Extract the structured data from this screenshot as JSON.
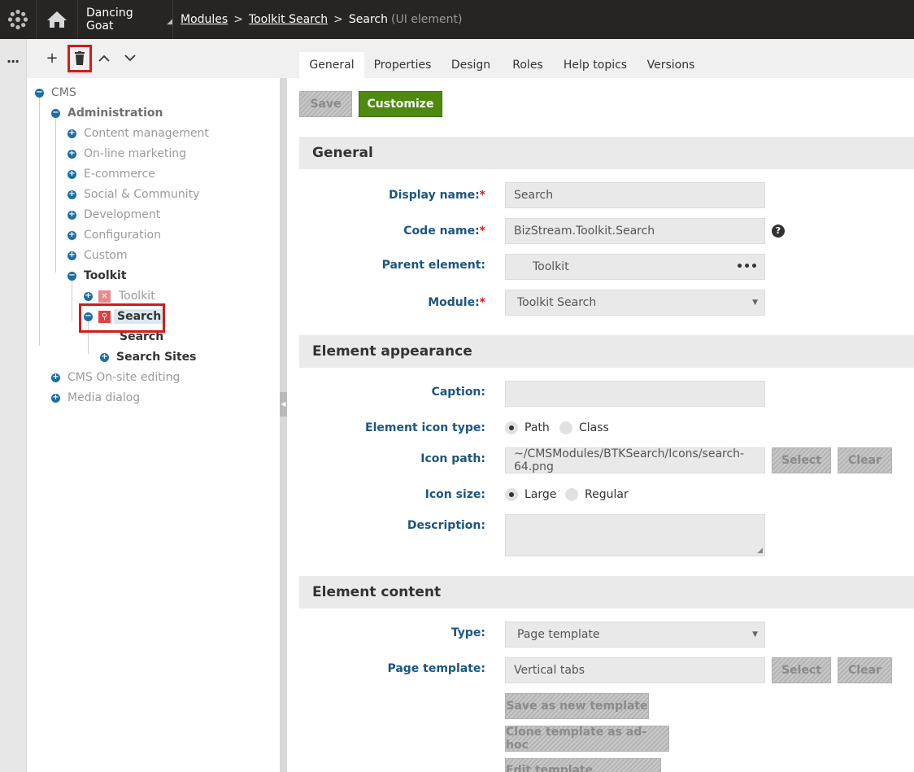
{
  "topbar": {
    "site_name": "Dancing Goat",
    "breadcrumbs": [
      "Modules",
      "Toolkit Search"
    ],
    "current": "Search",
    "current_suffix": "(UI element)"
  },
  "rail": {
    "menu_label": "..."
  },
  "tree_toolbar": {
    "add": "+",
    "up": "^",
    "down": "v"
  },
  "tree": {
    "root": "CMS",
    "administration": "Administration",
    "children": [
      "Content management",
      "On-line marketing",
      "E-commerce",
      "Social & Community",
      "Development",
      "Configuration",
      "Custom"
    ],
    "toolkit": "Toolkit",
    "toolkit_child": "Toolkit",
    "search": "Search",
    "search_child": "Search",
    "search_sites": "Search Sites",
    "cms_onsite": "CMS On-site editing",
    "media_dialog": "Media dialog"
  },
  "tabs": [
    "General",
    "Properties",
    "Design",
    "Roles",
    "Help topics",
    "Versions"
  ],
  "actions": {
    "save": "Save",
    "customize": "Customize"
  },
  "sections": {
    "general": "General",
    "appearance": "Element appearance",
    "content": "Element content"
  },
  "form": {
    "display_name": {
      "label": "Display name:",
      "value": "Search"
    },
    "code_name": {
      "label": "Code name:",
      "value": "BizStream.Toolkit.Search"
    },
    "parent_element": {
      "label": "Parent element:",
      "value": "Toolkit"
    },
    "module": {
      "label": "Module:",
      "value": "Toolkit Search"
    },
    "caption": {
      "label": "Caption:",
      "value": ""
    },
    "icon_type": {
      "label": "Element icon type:",
      "options": [
        "Path",
        "Class"
      ],
      "selected": "Path"
    },
    "icon_path": {
      "label": "Icon path:",
      "value": "~/CMSModules/BTKSearch/Icons/search-64.png",
      "select": "Select",
      "clear": "Clear"
    },
    "icon_size": {
      "label": "Icon size:",
      "options": [
        "Large",
        "Regular"
      ],
      "selected": "Large"
    },
    "description": {
      "label": "Description:",
      "value": ""
    },
    "type": {
      "label": "Type:",
      "value": "Page template"
    },
    "page_template": {
      "label": "Page template:",
      "value": "Vertical tabs",
      "select": "Select",
      "clear": "Clear"
    },
    "save_new_template": "Save as new template",
    "clone_template": "Clone template as ad-hoc",
    "edit_template": "Edit template properties"
  },
  "colors": {
    "accent_green": "#4f8a10",
    "label_blue": "#1c5680",
    "highlight_red": "#d51a1a",
    "topbar": "#262524"
  }
}
